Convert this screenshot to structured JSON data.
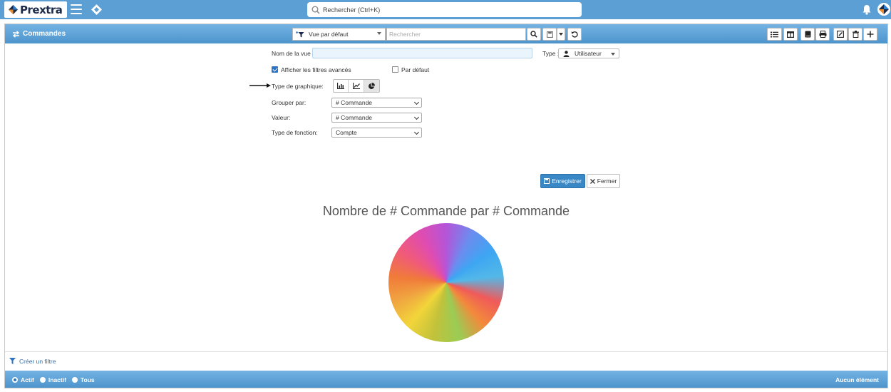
{
  "app": {
    "logo_text": "Prextra",
    "global_search_placeholder": "Rechercher (Ctrl+K)"
  },
  "subbar": {
    "title": "Commandes",
    "view_selected": "Vue par défaut",
    "search_placeholder": "Rechercher"
  },
  "form": {
    "view_name_label": "Nom de la vue :",
    "view_name_value": "",
    "type_label": "Type :",
    "type_value": "Utilisateur",
    "show_advanced_filters_label": "Afficher les filtres avancés",
    "show_advanced_filters_checked": true,
    "default_label": "Par défaut",
    "default_checked": false,
    "chart_type_label": "Type de graphique:",
    "chart_type_selected": "pie",
    "group_by_label": "Grouper par:",
    "group_by_value": "# Commande",
    "value_label": "Valeur:",
    "value_value": "# Commande",
    "function_type_label": "Type de fonction:",
    "function_type_value": "Compte",
    "save_label": "Enregistrer",
    "close_label": "Fermer"
  },
  "chart_data": {
    "type": "pie",
    "title": "Nombre de # Commande par # Commande",
    "categories": [],
    "values": []
  },
  "footer": {
    "create_filter_label": "Créer un filtre",
    "radio_active": "Actif",
    "radio_inactive": "Inactif",
    "radio_all": "Tous",
    "radio_selected": "Actif",
    "status_text": "Aucun élément"
  }
}
